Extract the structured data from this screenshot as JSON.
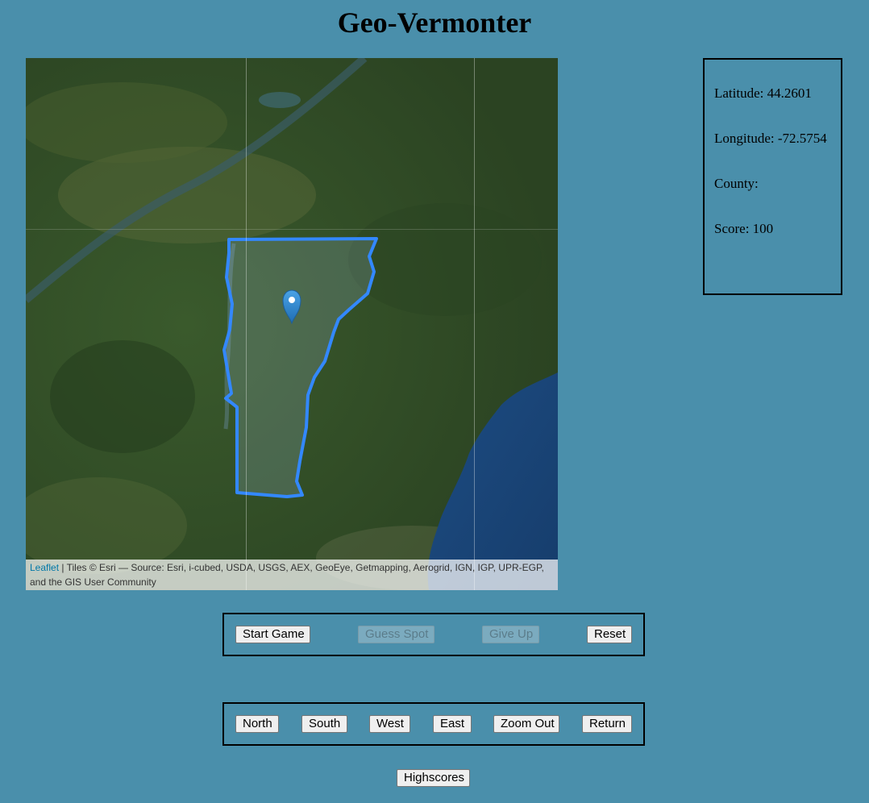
{
  "page": {
    "title": "Geo-Vermonter"
  },
  "map": {
    "attribution_link": "Leaflet",
    "attribution_text": " | Tiles © Esri — Source: Esri, i-cubed, USDA, USGS, AEX, GeoEye, Getmapping, Aerogrid, IGN, IGP, UPR-EGP, and the GIS User Community",
    "marker_icon": "map-pin-icon",
    "outline_color": "#3388ff",
    "water_color": "#1e4a7e",
    "land_color": "#2f4a26"
  },
  "info": {
    "latitude": "Latitude: 44.2601",
    "longitude": "Longitude: -72.5754",
    "county": "County:",
    "score": "Score: 100"
  },
  "game_controls": {
    "start": "Start Game",
    "guess": "Guess Spot",
    "give_up": "Give Up",
    "reset": "Reset"
  },
  "nav_controls": {
    "north": "North",
    "south": "South",
    "west": "West",
    "east": "East",
    "zoom_out": "Zoom Out",
    "return": "Return"
  },
  "highscores": {
    "label": "Highscores"
  }
}
